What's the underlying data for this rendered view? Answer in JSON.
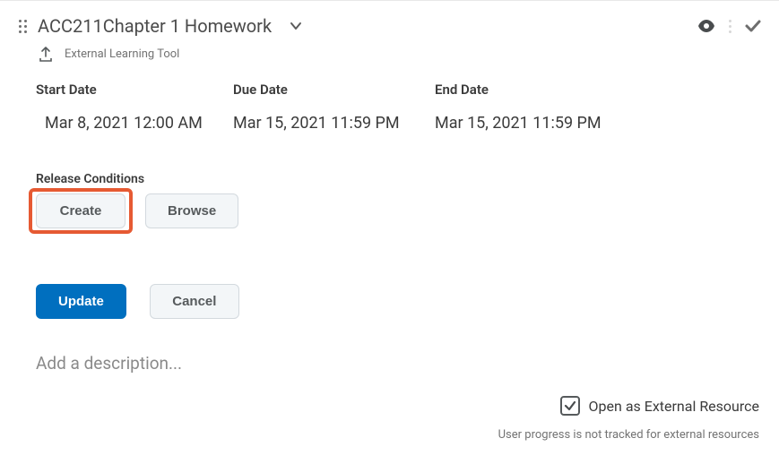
{
  "header": {
    "title": "ACC211Chapter 1 Homework",
    "subhead": "External Learning Tool"
  },
  "dates": {
    "start_label": "Start Date",
    "start_value": "Mar 8, 2021 12:00 AM",
    "due_label": "Due Date",
    "due_value": "Mar 15, 2021 11:59 PM",
    "end_label": "End Date",
    "end_value": "Mar 15, 2021 11:59 PM"
  },
  "release": {
    "section_label": "Release Conditions",
    "create_label": "Create",
    "browse_label": "Browse"
  },
  "actions": {
    "update_label": "Update",
    "cancel_label": "Cancel"
  },
  "description": {
    "placeholder": "Add a description..."
  },
  "external": {
    "checkbox_label": "Open as External Resource",
    "checked": true,
    "footnote": "User progress is not tracked for external resources"
  }
}
